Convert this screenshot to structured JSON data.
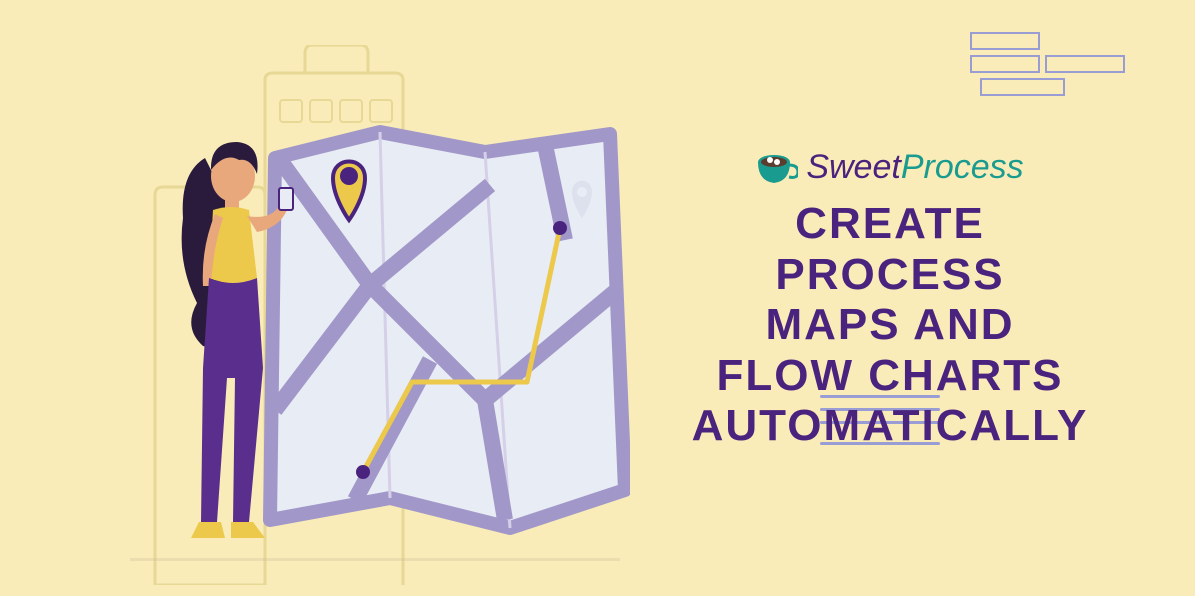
{
  "brand": {
    "sweet": "Sweet",
    "process": "Process",
    "icon": "coffee-cup"
  },
  "headline": {
    "line1": "CREATE",
    "line2": "PROCESS",
    "line3": "MAPS AND",
    "line4": "FLOW CHARTS",
    "line5": "AUTOMATICALLY"
  },
  "colors": {
    "background": "#f9ecb8",
    "accent": "#4a237e",
    "teal": "#1a9b8f",
    "lavender": "#9a9dd4",
    "map_fill": "#e8ecf4",
    "map_border": "#a198c9",
    "person_hair": "#2a1b3d",
    "person_shirt": "#ecc94b",
    "person_pants": "#5a2e8c",
    "pin": "#ecc94b"
  }
}
